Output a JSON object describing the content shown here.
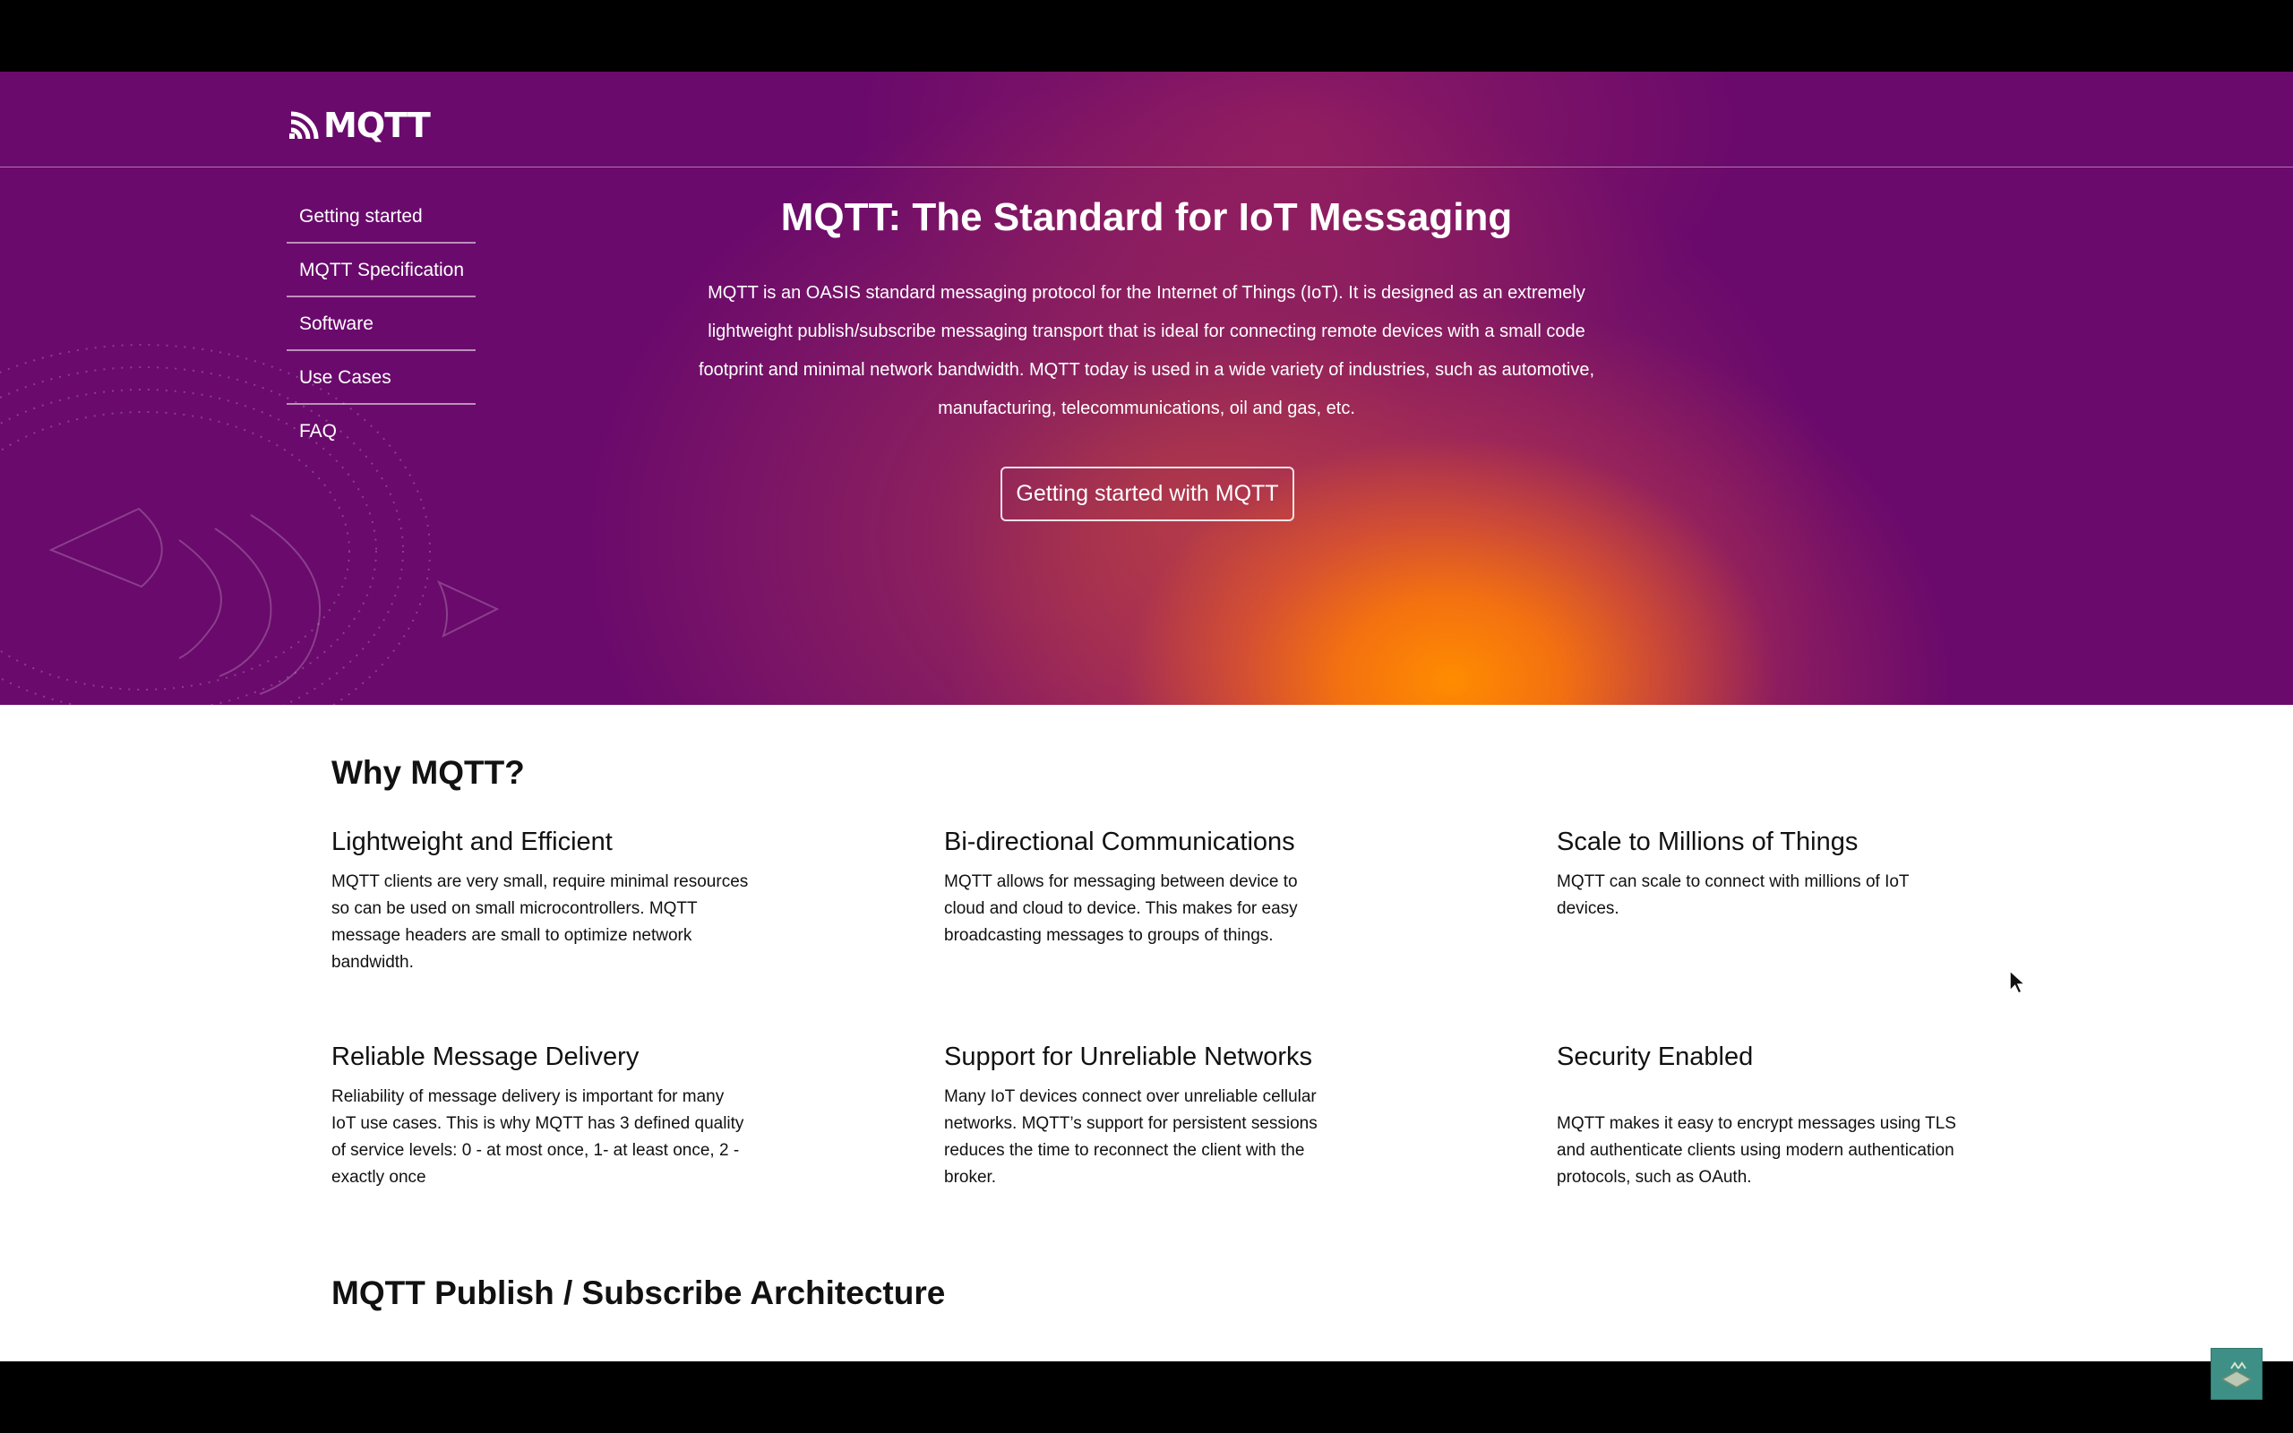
{
  "header": {
    "logo_text": "MQTT",
    "logo_icon": "signal-waves-icon"
  },
  "sidebar": {
    "items": [
      {
        "label": "Getting started"
      },
      {
        "label": "MQTT Specification"
      },
      {
        "label": "Software"
      },
      {
        "label": "Use Cases"
      },
      {
        "label": "FAQ"
      }
    ]
  },
  "hero": {
    "title": "MQTT: The Standard for IoT Messaging",
    "description": "MQTT is an OASIS standard messaging protocol for the Internet of Things (IoT). It is designed as an extremely lightweight publish/subscribe messaging transport that is ideal for connecting remote devices with a small code footprint and minimal network bandwidth. MQTT today is used in a wide variety of industries, such as automotive, manufacturing, telecommunications, oil and gas, etc.",
    "cta_label": "Getting started with MQTT"
  },
  "why": {
    "title": "Why MQTT?",
    "features": [
      {
        "title": "Lightweight and Efficient",
        "text": "MQTT clients are very small, require minimal resources so can be used on small microcontrollers. MQTT message headers are small to optimize network bandwidth."
      },
      {
        "title": "Bi-directional Communications",
        "text": "MQTT allows for messaging between device to cloud and cloud to device. This makes for easy broadcasting messages to groups of things."
      },
      {
        "title": "Scale to Millions of Things",
        "text": "MQTT can scale to connect with millions of IoT devices."
      },
      {
        "title": "Reliable Message Delivery",
        "text": "Reliability of message delivery is important for many IoT use cases. This is why MQTT has 3 defined quality of service levels: 0 - at most once, 1- at least once, 2 - exactly once"
      },
      {
        "title": "Support for Unreliable Networks",
        "text": "Many IoT devices connect over unreliable cellular networks. MQTT’s support for persistent sessions reduces the time to reconnect the client with the broker."
      },
      {
        "title": "Security Enabled",
        "text": "MQTT makes it easy to encrypt messages using TLS and authenticate clients using modern authentication protocols, such as OAuth."
      }
    ]
  },
  "architecture": {
    "title": "MQTT Publish / Subscribe Architecture"
  },
  "colors": {
    "hero_purple": "#6a0a6c",
    "hero_orange": "#ff8c00",
    "scroll_button": "#3e9086"
  }
}
